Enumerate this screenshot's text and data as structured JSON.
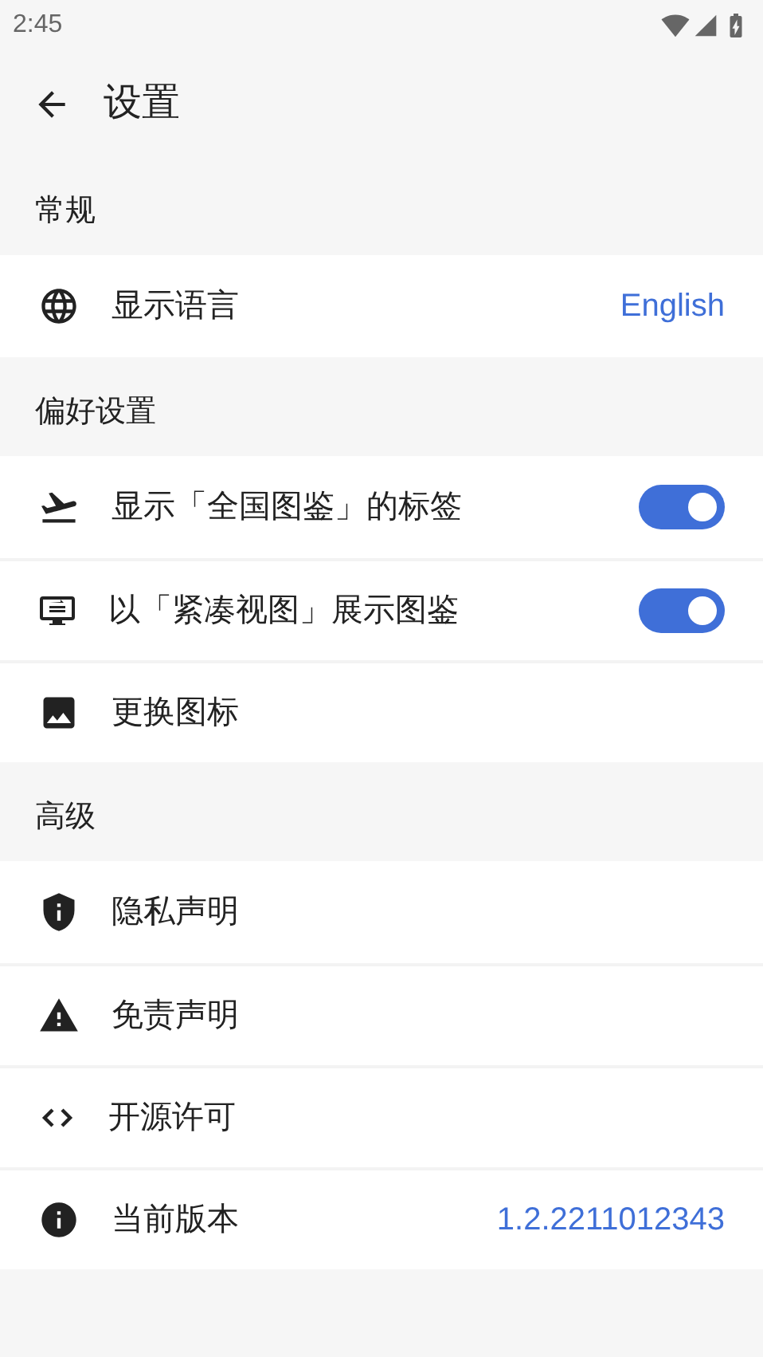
{
  "status_bar": {
    "time": "2:45"
  },
  "header": {
    "title": "设置"
  },
  "sections": [
    {
      "title": "常规",
      "items": [
        {
          "kind": "value",
          "label": "显示语言",
          "value": "English"
        }
      ]
    },
    {
      "title": "偏好设置",
      "items": [
        {
          "kind": "toggle",
          "label": "显示「全国图鉴」的标签",
          "on": true
        },
        {
          "kind": "toggle",
          "label": "以「紧凑视图」展示图鉴",
          "on": true
        },
        {
          "kind": "plain",
          "label": "更换图标"
        }
      ]
    },
    {
      "title": "高级",
      "items": [
        {
          "kind": "plain",
          "label": "隐私声明"
        },
        {
          "kind": "plain",
          "label": "免责声明"
        },
        {
          "kind": "plain",
          "label": "开源许可"
        },
        {
          "kind": "value",
          "label": "当前版本",
          "value": "1.2.2211012343"
        }
      ]
    }
  ]
}
